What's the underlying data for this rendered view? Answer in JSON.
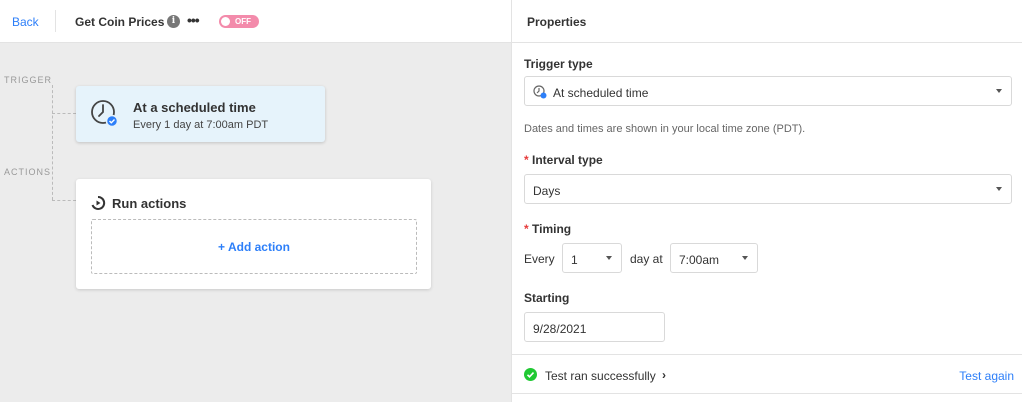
{
  "header": {
    "back_label": "Back",
    "automation_title": "Get Coin Prices",
    "info_icon": "info-icon",
    "more_label": "•••",
    "toggle_label": "OFF",
    "toggle_color": "#f38bab"
  },
  "canvas": {
    "trigger_section_label": "TRIGGER",
    "actions_section_label": "ACTIONS",
    "trigger_card": {
      "icon": "clock-icon",
      "title": "At a scheduled time",
      "subtitle": "Every 1 day at 7:00am PDT"
    },
    "actions_card": {
      "icon": "run-actions-icon",
      "title": "Run actions",
      "add_action_label": "+ Add action"
    }
  },
  "properties": {
    "title": "Properties",
    "trigger_type_label": "Trigger type",
    "trigger_type_value": "At scheduled time",
    "timezone_hint": "Dates and times are shown in your local time zone (PDT).",
    "interval_type_label": "Interval type",
    "interval_type_value": "Days",
    "timing_label": "Timing",
    "every_label": "Every",
    "every_value": "1",
    "day_at_label": "day at",
    "time_value": "7:00am",
    "starting_label": "Starting",
    "starting_value": "9/28/2021",
    "required_mark": "*",
    "test_status": "Test ran successfully",
    "test_status_chevron": "›",
    "test_again_label": "Test again"
  },
  "colors": {
    "accent": "#2d7ff9",
    "success": "#20c933",
    "required": "#e63b3b",
    "trigger_card_bg": "#e6f3fb"
  }
}
